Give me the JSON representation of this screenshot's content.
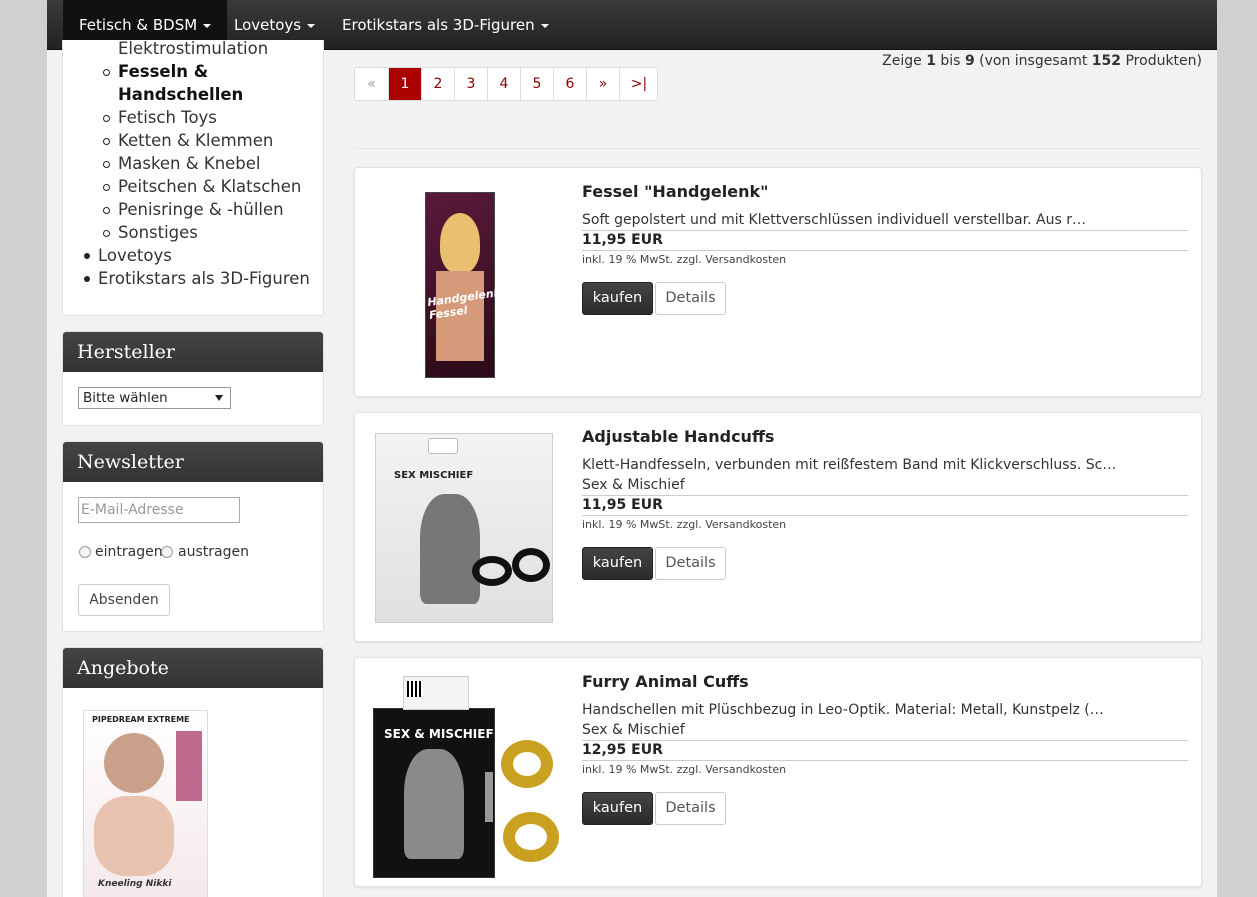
{
  "nav": {
    "items": [
      {
        "label": "Fetisch & BDSM"
      },
      {
        "label": "Lovetoys"
      },
      {
        "label": "Erotikstars als 3D-Figuren"
      }
    ]
  },
  "categories": {
    "partial_label": "Elektrostimulation",
    "active_label_line1": "Fesseln &",
    "active_label_line2": "Handschellen",
    "sub_items": [
      "Fetisch Toys",
      "Ketten & Klemmen",
      "Masken & Knebel",
      "Peitschen & Klatschen",
      "Penisringe & -hüllen",
      "Sonstiges"
    ],
    "top_items": [
      "Lovetoys",
      "Erotikstars als 3D-Figuren"
    ]
  },
  "manufacturer": {
    "title": "Hersteller",
    "select_value": "Bitte wählen"
  },
  "newsletter": {
    "title": "Newsletter",
    "email_placeholder": "E-Mail-Adresse",
    "radio_subscribe": "eintragen",
    "radio_unsubscribe": "austragen",
    "submit_label": "Absenden"
  },
  "offers": {
    "title": "Angebote",
    "image_brand": "PIPEDREAM EXTREME",
    "image_name": "Kneeling Nikki"
  },
  "pagination": {
    "first": "«",
    "pages": [
      "1",
      "2",
      "3",
      "4",
      "5",
      "6"
    ],
    "active_page": "1",
    "next": "»",
    "last": ">|"
  },
  "result_count": {
    "prefix": "Zeige",
    "from": "1",
    "mid": "bis",
    "to": "9",
    "open": "(von insgesamt",
    "total": "152",
    "suffix": "Produkten)"
  },
  "products": [
    {
      "title": "Fessel \"Handgelenk\"",
      "description": "Soft gepolstert und mit Klettverschlüssen individuell verstellbar. Aus r…",
      "manufacturer": "",
      "price": "11,95 EUR",
      "tax_note": "inkl. 19 % MwSt. zzgl. Versandkosten",
      "buy_label": "kaufen",
      "details_label": "Details",
      "image_text": "Handgelenk Fessel"
    },
    {
      "title": "Adjustable Handcuffs",
      "description": "Klett-Handfesseln, verbunden mit reißfestem Band mit Klickverschluss. Sc…",
      "manufacturer": "Sex & Mischief",
      "price": "11,95 EUR",
      "tax_note": "inkl. 19 % MwSt. zzgl. Versandkosten",
      "buy_label": "kaufen",
      "details_label": "Details",
      "image_text": "SEX MISCHIEF"
    },
    {
      "title": "Furry Animal Cuffs",
      "description": "Handschellen mit Plüschbezug in Leo-Optik. Material: Metall, Kunstpelz (…",
      "manufacturer": "Sex & Mischief",
      "price": "12,95 EUR",
      "tax_note": "inkl. 19 % MwSt. zzgl. Versandkosten",
      "buy_label": "kaufen",
      "details_label": "Details",
      "image_text": "SEX & MISCHIEF"
    }
  ],
  "colors": {
    "accent": "#aa0000",
    "nav_bg": "#2b2b2b",
    "page_bg": "#f2f2f2"
  }
}
